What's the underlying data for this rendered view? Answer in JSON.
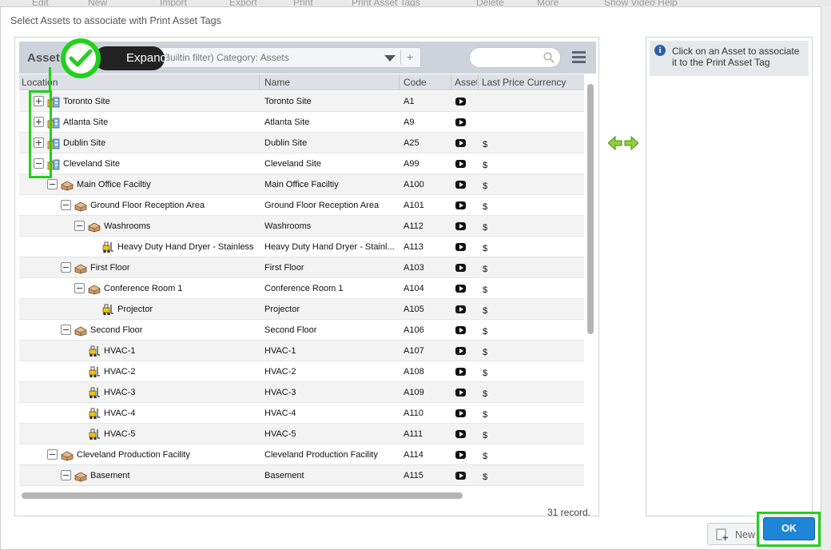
{
  "background_toolbar": [
    "Edit",
    "New",
    "Import",
    "Export",
    "Print",
    "Print Asset Tags",
    "Delete",
    "More",
    "Show Video Help"
  ],
  "dialog": {
    "title": "Select Assets to associate with Print Asset Tags"
  },
  "left_panel": {
    "title": "Asset",
    "filter_text": "(Builtin filter) Category: Assets",
    "columns": [
      "Location",
      "Name",
      "Code",
      "Asset",
      "Last Price Currency"
    ],
    "rows": [
      {
        "indent": 0,
        "toggle": "plus",
        "icon": "site-icon",
        "location": "Toronto Site",
        "name": "Toronto Site",
        "code": "A1",
        "currency": ""
      },
      {
        "indent": 0,
        "toggle": "plus",
        "icon": "site-icon",
        "location": "Atlanta Site",
        "name": "Atlanta Site",
        "code": "A9",
        "currency": ""
      },
      {
        "indent": 0,
        "toggle": "plus",
        "icon": "site-icon",
        "location": "Dublin Site",
        "name": "Dublin Site",
        "code": "A25",
        "currency": "$"
      },
      {
        "indent": 0,
        "toggle": "minus",
        "icon": "site-icon",
        "location": "Cleveland Site",
        "name": "Cleveland Site",
        "code": "A99",
        "currency": "$"
      },
      {
        "indent": 1,
        "toggle": "minus",
        "icon": "building-icon",
        "location": "Main Office Faciltiy",
        "name": "Main Office Faciltiy",
        "code": "A100",
        "currency": "$"
      },
      {
        "indent": 2,
        "toggle": "minus",
        "icon": "building-icon",
        "location": "Ground Floor Reception Area",
        "name": "Ground Floor Reception Area",
        "code": "A101",
        "currency": "$"
      },
      {
        "indent": 3,
        "toggle": "minus",
        "icon": "building-icon",
        "location": "Washrooms",
        "name": "Washrooms",
        "code": "A112",
        "currency": "$"
      },
      {
        "indent": 4,
        "toggle": "",
        "icon": "forklift-icon",
        "location": "Heavy Duty Hand Dryer - Stainless ...",
        "name": "Heavy Duty Hand Dryer - Stainl...",
        "code": "A113",
        "currency": "$"
      },
      {
        "indent": 2,
        "toggle": "minus",
        "icon": "building-icon",
        "location": "First Floor",
        "name": "First Floor",
        "code": "A103",
        "currency": "$"
      },
      {
        "indent": 3,
        "toggle": "minus",
        "icon": "building-icon",
        "location": "Conference Room 1",
        "name": "Conference Room 1",
        "code": "A104",
        "currency": "$"
      },
      {
        "indent": 4,
        "toggle": "",
        "icon": "forklift-icon",
        "location": "Projector",
        "name": "Projector",
        "code": "A105",
        "currency": "$"
      },
      {
        "indent": 2,
        "toggle": "minus",
        "icon": "building-icon",
        "location": "Second Floor",
        "name": "Second Floor",
        "code": "A106",
        "currency": "$"
      },
      {
        "indent": 3,
        "toggle": "",
        "icon": "forklift-icon",
        "location": "HVAC-1",
        "name": "HVAC-1",
        "code": "A107",
        "currency": "$"
      },
      {
        "indent": 3,
        "toggle": "",
        "icon": "forklift-icon",
        "location": "HVAC-2",
        "name": "HVAC-2",
        "code": "A108",
        "currency": "$"
      },
      {
        "indent": 3,
        "toggle": "",
        "icon": "forklift-icon",
        "location": "HVAC-3",
        "name": "HVAC-3",
        "code": "A109",
        "currency": "$"
      },
      {
        "indent": 3,
        "toggle": "",
        "icon": "forklift-icon",
        "location": "HVAC-4",
        "name": "HVAC-4",
        "code": "A110",
        "currency": "$"
      },
      {
        "indent": 3,
        "toggle": "",
        "icon": "forklift-icon",
        "location": "HVAC-5",
        "name": "HVAC-5",
        "code": "A111",
        "currency": "$"
      },
      {
        "indent": 1,
        "toggle": "minus",
        "icon": "building-icon",
        "location": "Cleveland Production Facility",
        "name": "Cleveland Production Facility",
        "code": "A114",
        "currency": "$"
      },
      {
        "indent": 2,
        "toggle": "minus",
        "icon": "building-icon",
        "location": "Basement",
        "name": "Basement",
        "code": "A115",
        "currency": "$"
      }
    ],
    "record_count": "31 record."
  },
  "right_panel": {
    "info_text": "Click on an Asset to associate it to the Print Asset Tag"
  },
  "buttons": {
    "new_label": "New",
    "ok_label": "OK"
  },
  "callout": {
    "label": "Expand"
  },
  "colors": {
    "highlight": "#21d11b",
    "ok_button": "#1f86d7",
    "header_bar": "#cdd3db"
  }
}
